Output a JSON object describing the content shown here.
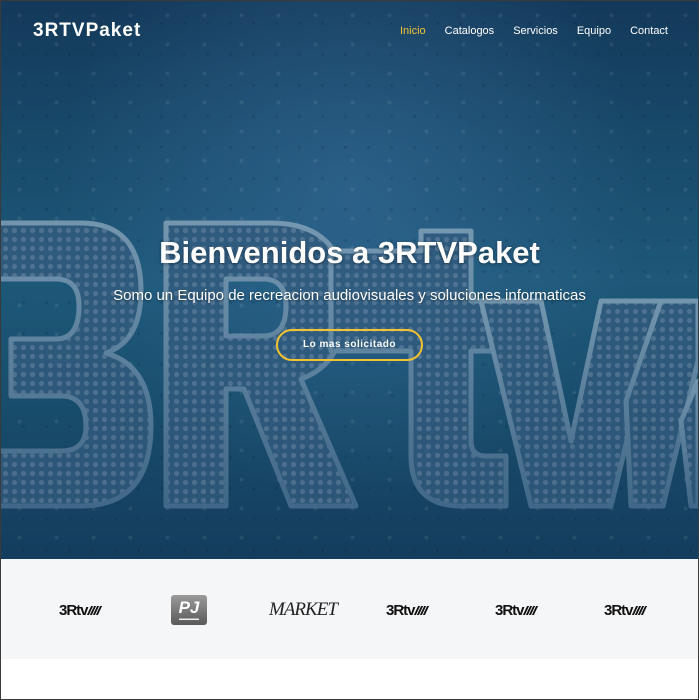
{
  "nav": {
    "brand": "3RTVPaket",
    "items": [
      {
        "label": "Inicio",
        "active": true
      },
      {
        "label": "Catalogos",
        "active": false
      },
      {
        "label": "Servicios",
        "active": false
      },
      {
        "label": "Equipo",
        "active": false
      },
      {
        "label": "Contact",
        "active": false
      }
    ]
  },
  "hero": {
    "title": "Bienvenidos a 3RTVPaket",
    "subtitle": "Somo un Equipo de recreacion audiovisuales y soluciones informaticas",
    "cta_label": "Lo mas solicitado",
    "background_logo": "3Rtv"
  },
  "clients": [
    {
      "name": "3Rtv",
      "kind": "3rtv-logo"
    },
    {
      "name": "PJ",
      "kind": "pj-logo"
    },
    {
      "name": "MARKET",
      "kind": "market-logo"
    },
    {
      "name": "3Rtv",
      "kind": "3rtv-logo"
    },
    {
      "name": "3Rtv",
      "kind": "3rtv-logo"
    },
    {
      "name": "3Rtv",
      "kind": "3rtv-logo"
    }
  ],
  "colors": {
    "accent": "#f2c230",
    "hero_bg": "#1d5477",
    "clients_bg": "#f5f6f8"
  }
}
